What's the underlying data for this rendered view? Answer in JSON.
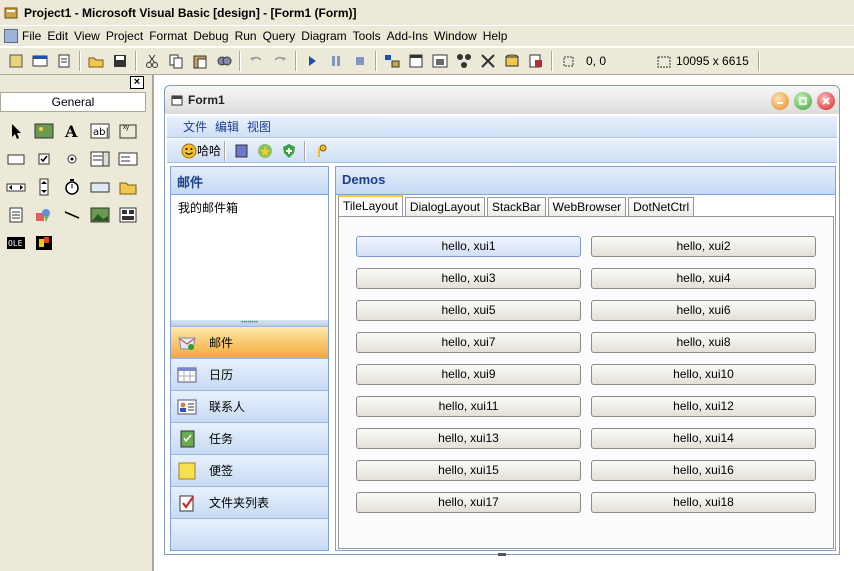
{
  "titlebar": {
    "title": "Project1 - Microsoft Visual Basic [design] - [Form1 (Form)]"
  },
  "menubar": {
    "items": [
      "File",
      "Edit",
      "View",
      "Project",
      "Format",
      "Debug",
      "Run",
      "Query",
      "Diagram",
      "Tools",
      "Add-Ins",
      "Window",
      "Help"
    ]
  },
  "toolbar": {
    "position": "0, 0",
    "size": "10095 x 6615"
  },
  "toolbox": {
    "close": "×",
    "tab": "General",
    "tools": [
      "pointer-icon",
      "picturebox-icon",
      "label-icon",
      "textbox-icon",
      "frame-icon",
      "commandbutton-icon",
      "checkbox-icon",
      "optionbutton-icon",
      "combobox-icon",
      "listbox-icon",
      "hscrollbar-icon",
      "vscrollbar-icon",
      "timer-icon",
      "drivelistbox-icon",
      "dirlistbox-icon",
      "filelistbox-icon",
      "shape-icon",
      "line-icon",
      "image-icon",
      "data-icon",
      "ole-icon",
      "custom-control-icon"
    ]
  },
  "form": {
    "title": "Form1",
    "menu": [
      "文件",
      "编辑",
      "视图"
    ],
    "toolbar": {
      "smile_label": "哈哈"
    },
    "mail": {
      "header": "邮件",
      "mailbox": "我的邮件箱",
      "nav": [
        {
          "label": "邮件",
          "active": true
        },
        {
          "label": "日历"
        },
        {
          "label": "联系人"
        },
        {
          "label": "任务"
        },
        {
          "label": "便签"
        },
        {
          "label": "文件夹列表"
        }
      ]
    },
    "demos": {
      "header": "Demos",
      "tabs": [
        "TileLayout",
        "DialogLayout",
        "StackBar",
        "WebBrowser",
        "DotNetCtrl"
      ],
      "buttons": [
        "hello, xui1",
        "hello, xui2",
        "hello, xui3",
        "hello, xui4",
        "hello, xui5",
        "hello, xui6",
        "hello, xui7",
        "hello, xui8",
        "hello, xui9",
        "hello, xui10",
        "hello, xui11",
        "hello, xui12",
        "hello, xui13",
        "hello, xui14",
        "hello, xui15",
        "hello, xui16",
        "hello, xui17",
        "hello, xui18"
      ]
    }
  }
}
